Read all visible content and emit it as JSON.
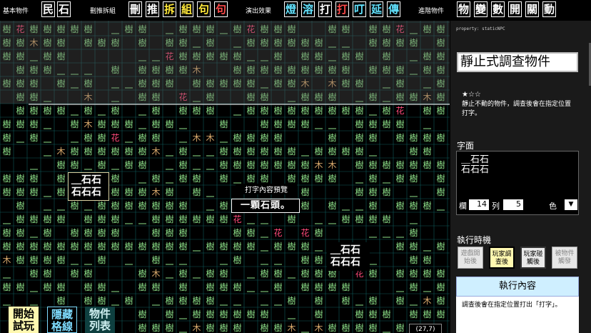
{
  "toolbar": {
    "groups": [
      {
        "label": "基本物件",
        "buttons": [
          "民",
          "石"
        ]
      },
      {
        "label": "刪推拆組",
        "buttons": [
          "刪",
          "推",
          "拆",
          "組",
          "句",
          "句"
        ]
      },
      {
        "label": "演出效果",
        "buttons": [
          "燈",
          "溶",
          "打",
          "打",
          "叮",
          "延",
          "傳"
        ]
      },
      {
        "label": "進階物件",
        "buttons": [
          "物",
          "變",
          "數",
          "開",
          "關",
          "動"
        ]
      }
    ]
  },
  "board": {
    "tree_char": "樹",
    "wood_char": "木",
    "flower_char": "花",
    "rock_block_left": [
      "＿石石",
      "石石石"
    ],
    "rock_block_right": [
      "＿石石",
      "石石石"
    ],
    "preview_title": "打字內容預覽",
    "preview_text": "一顆石頭。",
    "buttons": {
      "start": "開始\n試玩",
      "hide_grid": "隱藏\n格線",
      "object_list": "物件\n列表"
    },
    "coords": "(27,7)"
  },
  "panel": {
    "property": "property: staticNPC",
    "title": "靜止式調查物件",
    "stars": "★☆☆",
    "description": "靜止不動的物件，調查後會在指定位置打字。",
    "glyph_label": "字面",
    "glyph_line1": "＿石石",
    "glyph_line2": "石石石",
    "col_label": "欄",
    "col_value": "14",
    "row_label": "列",
    "row_value": "5",
    "color_label": "色",
    "color_select": "▼",
    "timing_label": "執行時機",
    "triggers": [
      {
        "label": "遊戲開\n始後",
        "state": "off"
      },
      {
        "label": "玩家調\n查後",
        "state": "on"
      },
      {
        "label": "玩家碰\n觸後",
        "state": "mid"
      },
      {
        "label": "被物件\n觸發",
        "state": "off"
      }
    ],
    "exec_label": "執行內容",
    "exec_text": "調查後會在指定位置打出「打字」。"
  },
  "colors": {
    "tree": "#8ee28a",
    "wood": "#d7a86b",
    "flower": "#ff4a7a",
    "grid": "#0e5a5a",
    "accent_yellow": "#ffe83a",
    "accent_cyan": "#62e3ff"
  }
}
